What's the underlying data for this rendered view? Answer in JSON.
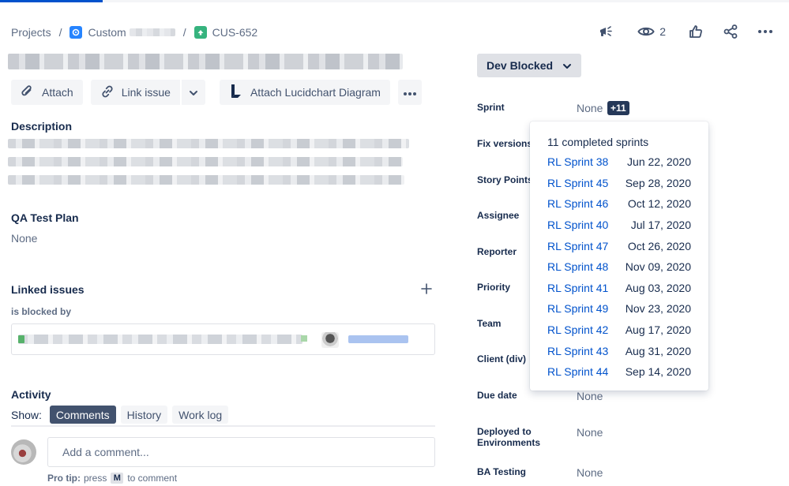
{
  "breadcrumb": {
    "projects": "Projects",
    "project_name": "Custom",
    "issue_key": "CUS-652"
  },
  "header": {
    "watch_count": "2"
  },
  "toolbar": {
    "attach": "Attach",
    "link_issue": "Link issue",
    "lucidchart": "Attach Lucidchart Diagram"
  },
  "description": {
    "heading": "Description"
  },
  "qa_test_plan": {
    "heading": "QA Test Plan",
    "value": "None"
  },
  "linked_issues": {
    "heading": "Linked issues",
    "relation": "is blocked by"
  },
  "activity": {
    "heading": "Activity",
    "show_label": "Show:",
    "tabs": [
      "Comments",
      "History",
      "Work log"
    ],
    "comment_placeholder": "Add a comment...",
    "pro_tip_label": "Pro tip:",
    "pro_tip_press": "press",
    "pro_tip_key": "M",
    "pro_tip_rest": "to comment"
  },
  "status": {
    "label": "Dev Blocked"
  },
  "fields": {
    "sprint": {
      "label": "Sprint",
      "value": "None",
      "badge": "+11"
    },
    "fix_versions": {
      "label": "Fix versions"
    },
    "story_points": {
      "label": "Story Points"
    },
    "assignee": {
      "label": "Assignee"
    },
    "reporter": {
      "label": "Reporter"
    },
    "priority": {
      "label": "Priority"
    },
    "team": {
      "label": "Team"
    },
    "client_div": {
      "label": "Client (div)"
    },
    "due_date": {
      "label": "Due date",
      "value": "None"
    },
    "deployed_env": {
      "label_line1": "Deployed to",
      "label_line2": "Environments",
      "value": "None"
    },
    "ba_testing": {
      "label": "BA Testing",
      "value": "None"
    }
  },
  "sprint_popup": {
    "title": "11 completed sprints",
    "sprints": [
      {
        "name": "RL Sprint 38",
        "date": "Jun 22, 2020"
      },
      {
        "name": "RL Sprint 45",
        "date": "Sep 28, 2020"
      },
      {
        "name": "RL Sprint 46",
        "date": "Oct 12, 2020"
      },
      {
        "name": "RL Sprint 40",
        "date": "Jul 17, 2020"
      },
      {
        "name": "RL Sprint 47",
        "date": "Oct 26, 2020"
      },
      {
        "name": "RL Sprint 48",
        "date": "Nov 09, 2020"
      },
      {
        "name": "RL Sprint 41",
        "date": "Aug 03, 2020"
      },
      {
        "name": "RL Sprint 49",
        "date": "Nov 23, 2020"
      },
      {
        "name": "RL Sprint 42",
        "date": "Aug 17, 2020"
      },
      {
        "name": "RL Sprint 43",
        "date": "Aug 31, 2020"
      },
      {
        "name": "RL Sprint 44",
        "date": "Sep 14, 2020"
      }
    ]
  },
  "colors": {
    "link": "#0052cc",
    "text": "#172b4d",
    "subtle": "#5e6c84",
    "story_type": "#36b37e",
    "project_icon": "#2684ff"
  }
}
